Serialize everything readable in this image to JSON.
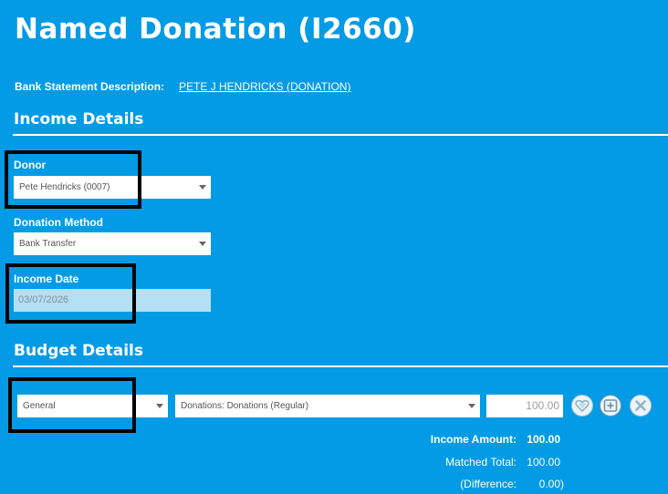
{
  "page": {
    "title": "Named Donation (I2660)"
  },
  "bank_statement": {
    "label": "Bank Statement Description:",
    "value": "PETE J HENDRICKS (DONATION)"
  },
  "income_details": {
    "heading": "Income Details",
    "donor": {
      "label": "Donor",
      "value": "Pete Hendricks (0007)"
    },
    "donation_method": {
      "label": "Donation Method",
      "value": "Bank Transfer"
    },
    "income_date": {
      "label": "Income Date",
      "value": "03/07/2026"
    }
  },
  "budget_details": {
    "heading": "Budget Details",
    "budget": "General",
    "category": "Donations: Donations (Regular)",
    "amount": "100.00",
    "icons": [
      "heart-icon",
      "split-add-icon",
      "remove-icon"
    ]
  },
  "summary": {
    "income_amount_label": "Income Amount:",
    "income_amount_value": "100.00",
    "matched_total_label": "Matched Total:",
    "matched_total_value": "100.00",
    "difference_label": "(Difference:",
    "difference_value": "0.00)"
  },
  "colors": {
    "background": "#039be5",
    "highlight": "#000000",
    "date_field": "#b3e0f5"
  }
}
